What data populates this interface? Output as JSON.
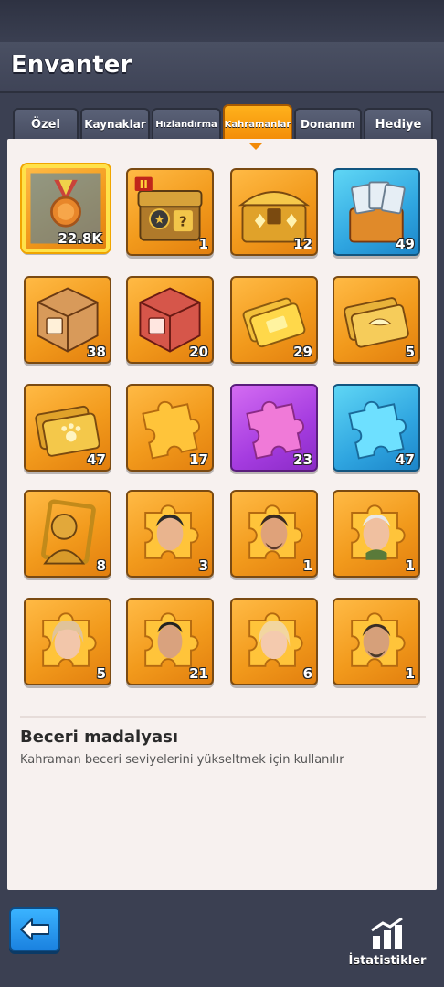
{
  "header": {
    "title": "Envanter"
  },
  "tabs": [
    {
      "label": "Özel"
    },
    {
      "label": "Kaynaklar"
    },
    {
      "label": "Hızlandırma"
    },
    {
      "label": "Kahramanlar",
      "active": true
    },
    {
      "label": "Donanım"
    },
    {
      "label": "Hediye"
    }
  ],
  "items": [
    {
      "icon": "skill-medal-icon",
      "count": "22.8K",
      "selected": true
    },
    {
      "icon": "hero-chest-ii-icon",
      "count": "1"
    },
    {
      "icon": "gold-chest-icon",
      "count": "12"
    },
    {
      "icon": "ticket-box-icon",
      "count": "49"
    },
    {
      "icon": "bronze-crate-icon",
      "count": "38"
    },
    {
      "icon": "red-crate-icon",
      "count": "20"
    },
    {
      "icon": "gold-card-icon",
      "count": "29"
    },
    {
      "icon": "winged-card-icon",
      "count": "5"
    },
    {
      "icon": "paw-card-icon",
      "count": "47"
    },
    {
      "icon": "orange-puzzle-icon",
      "count": "17"
    },
    {
      "icon": "purple-puzzle-icon",
      "count": "23"
    },
    {
      "icon": "blue-puzzle-icon",
      "count": "47"
    },
    {
      "icon": "gold-hero-frame-icon",
      "count": "8"
    },
    {
      "icon": "hero-fragment-icon",
      "count": "3"
    },
    {
      "icon": "hero-fragment-icon",
      "count": "1"
    },
    {
      "icon": "hero-fragment-icon",
      "count": "1"
    },
    {
      "icon": "hero-fragment-icon",
      "count": "5"
    },
    {
      "icon": "hero-fragment-icon",
      "count": "21"
    },
    {
      "icon": "hero-fragment-icon",
      "count": "6"
    },
    {
      "icon": "hero-fragment-icon",
      "count": "1"
    }
  ],
  "detail": {
    "title": "Beceri madalyası",
    "description": "Kahraman beceri seviyelerini yükseltmek için kullanılır"
  },
  "footer": {
    "stats_label": "İstatistikler"
  },
  "colors": {
    "accent": "#f28a06",
    "panel": "#f7f1ef",
    "back_button": "#1b82e0"
  }
}
